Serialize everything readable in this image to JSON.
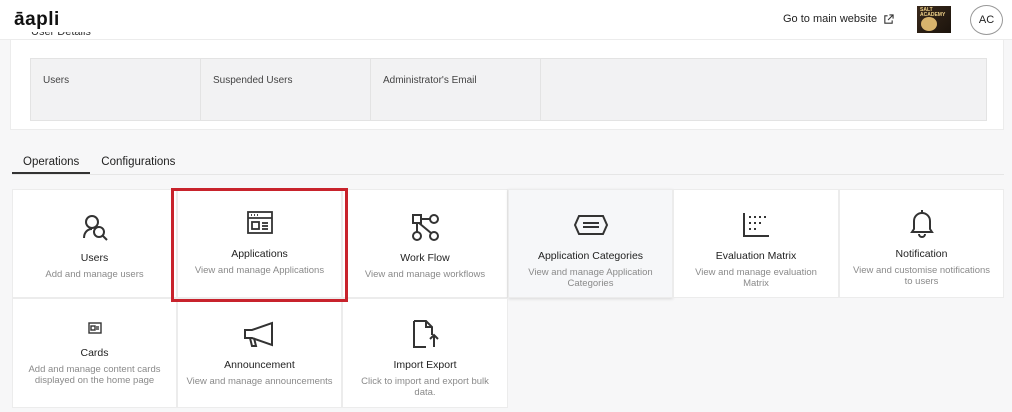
{
  "header": {
    "logo": "āapli",
    "go_main_label": "Go to main website",
    "avatar_initials": "AC",
    "thumb_text": "SALT ACADEMY"
  },
  "details": {
    "title": "User Details",
    "columns": [
      "Users",
      "Suspended Users",
      "Administrator's Email",
      ""
    ]
  },
  "tabs": [
    {
      "label": "Operations",
      "active": true
    },
    {
      "label": "Configurations",
      "active": false
    }
  ],
  "cards": [
    {
      "title": "Users",
      "desc": "Add and manage users",
      "icon": "users-icon"
    },
    {
      "title": "Applications",
      "desc": "View and manage Applications",
      "icon": "applications-icon"
    },
    {
      "title": "Work Flow",
      "desc": "View and manage workflows",
      "icon": "workflow-icon"
    },
    {
      "title": "Application Categories",
      "desc": "View and manage Application Categories",
      "icon": "categories-icon"
    },
    {
      "title": "Evaluation Matrix",
      "desc": "View and manage evaluation Matrix",
      "icon": "matrix-icon"
    },
    {
      "title": "Notification",
      "desc": "View and customise notifications to users",
      "icon": "bell-icon"
    },
    {
      "title": "Cards",
      "desc": "Add and manage content cards displayed on the home page",
      "icon": "cards-icon"
    },
    {
      "title": "Announcement",
      "desc": "View and manage announcements",
      "icon": "megaphone-icon"
    },
    {
      "title": "Import Export",
      "desc": "Click to import and export bulk data.",
      "icon": "import-export-icon"
    }
  ],
  "colors": {
    "highlight": "#c8232c"
  }
}
